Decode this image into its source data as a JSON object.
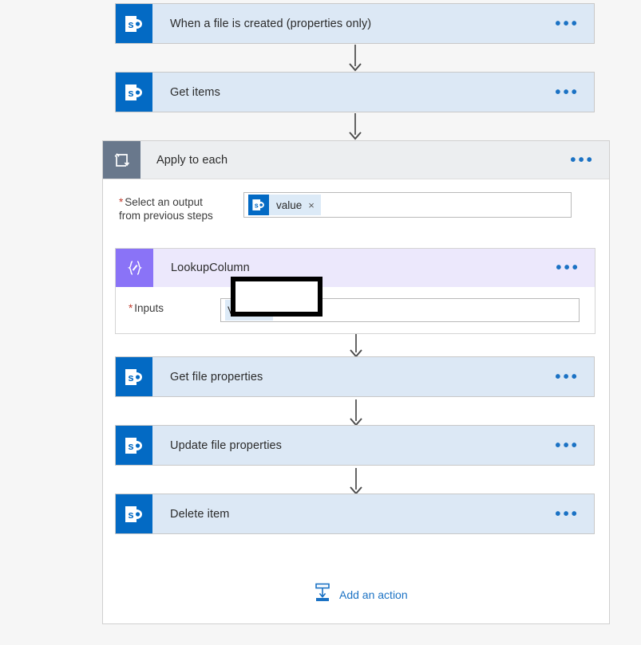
{
  "canvas": {
    "background": "#f6f6f6",
    "card_background": "#dce8f5",
    "sharepoint_blue": "#036ac4",
    "scope_icon_color": "#69788c",
    "compose_icon_color": "#8a73f7",
    "compose_header_color": "#ece8fc",
    "link_blue": "#1b72c4",
    "required_star_color": "#c0392b"
  },
  "trigger": {
    "title": "When a file is created (properties only)",
    "icon": "sharepoint-icon",
    "menu": "•••"
  },
  "steps": [
    {
      "title": "Get items",
      "icon": "sharepoint-icon",
      "menu": "•••"
    },
    {
      "title": "Get file properties",
      "icon": "sharepoint-icon",
      "menu": "•••"
    },
    {
      "title": "Update file properties",
      "icon": "sharepoint-icon",
      "menu": "•••"
    },
    {
      "title": "Delete item",
      "icon": "sharepoint-icon",
      "menu": "•••"
    }
  ],
  "scope": {
    "title": "Apply to each",
    "icon": "loop-icon",
    "menu": "•••",
    "select_output": {
      "required_marker": "*",
      "label_line1": "Select an output",
      "label_line2": "from previous steps",
      "token": {
        "text": "value",
        "icon": "sharepoint-icon",
        "remove": "×"
      }
    }
  },
  "compose": {
    "title": "LookupColumn",
    "icon": "compose-expression-icon",
    "menu": "•••",
    "inputs": {
      "required_marker": "*",
      "label": "Inputs",
      "token": {
        "text": "Value",
        "remove": "×"
      }
    }
  },
  "add_action": {
    "label": "Add an action",
    "icon": "insert-step-icon"
  },
  "redaction": {
    "present": true,
    "fill": "#ffffff",
    "border": "#000000"
  }
}
